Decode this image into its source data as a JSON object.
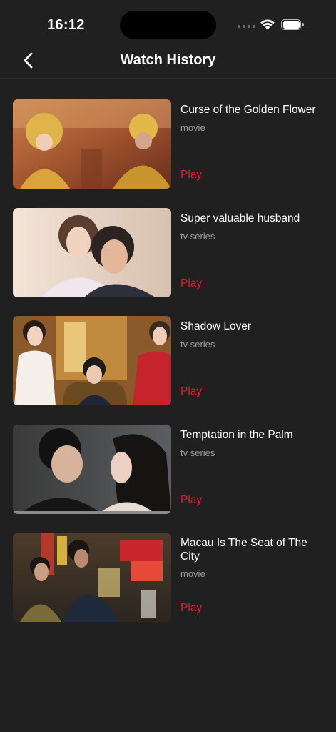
{
  "status_bar": {
    "time": "16:12"
  },
  "nav": {
    "title": "Watch History",
    "back_icon": "chevron-left-icon"
  },
  "colors": {
    "background": "#202020",
    "accent": "#e8182b",
    "secondary_text": "#9a9a9a"
  },
  "items": [
    {
      "title": "Curse of the Golden Flower",
      "type": "movie",
      "action": "Play"
    },
    {
      "title": "Super valuable husband",
      "type": "tv series",
      "action": "Play"
    },
    {
      "title": "Shadow Lover",
      "type": "tv series",
      "action": "Play"
    },
    {
      "title": "Temptation in the Palm",
      "type": "tv series",
      "action": "Play"
    },
    {
      "title": "Macau Is The Seat of The City",
      "type": "movie",
      "action": "Play"
    }
  ]
}
